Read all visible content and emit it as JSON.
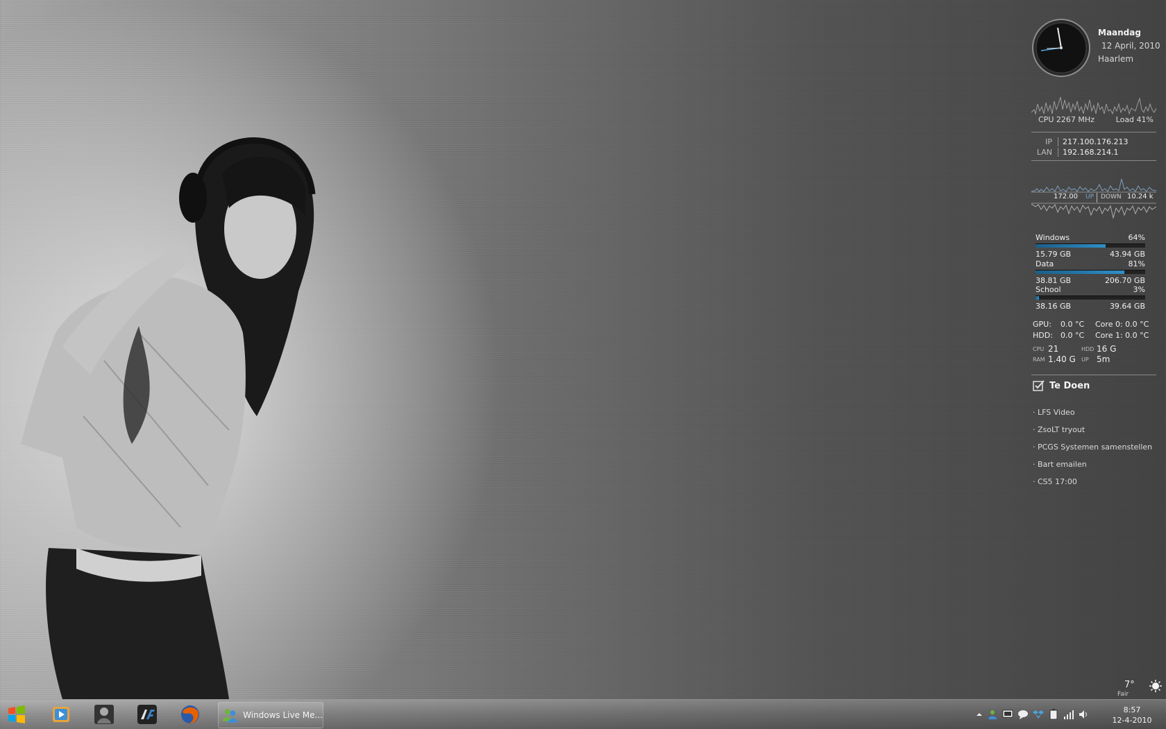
{
  "clock": {
    "day": "Maandag",
    "date": "12 April, 2010",
    "city": "Haarlem"
  },
  "cpu": {
    "mhz": "CPU 2267 MHz",
    "load": "Load 41%"
  },
  "network": {
    "ip_label": "IP",
    "ip": "217.100.176.213",
    "lan_label": "LAN",
    "lan": "192.168.214.1",
    "up_value": "172.00",
    "up_label": "UP",
    "down_label": "DOWN",
    "down_value": "10.24 k"
  },
  "drives": [
    {
      "name": "Windows",
      "percent_label": "64%",
      "used": "15.79 GB",
      "total": "43.94 GB",
      "fill": 0.64
    },
    {
      "name": "Data",
      "percent_label": "81%",
      "used": "38.81 GB",
      "total": "206.70 GB",
      "fill": 0.81
    },
    {
      "name": "School",
      "percent_label": "3%",
      "used": "38.16 GB",
      "total": "39.64 GB",
      "fill": 0.03
    }
  ],
  "temps": {
    "gpu_label": "GPU:",
    "gpu": "0.0 °C",
    "core0": "Core 0: 0.0 °C",
    "hdd_label": "HDD:",
    "hdd": "0.0 °C",
    "core1": "Core 1: 0.0 °C"
  },
  "mini": {
    "cpu_label": "CPU",
    "cpu": "21",
    "hdd_label": "HDD",
    "hdd": "16 G",
    "ram_label": "RAM",
    "ram": "1.40 G",
    "up_label": "UP",
    "up": "5m"
  },
  "todo": {
    "title": "Te Doen",
    "items": [
      "· LFS Video",
      "· ZsoLT tryout",
      "· PCGS Systemen samenstellen",
      "· Bart emailen",
      "· CS5 17:00"
    ]
  },
  "weather": {
    "temp": "7°",
    "condition": "Fair"
  },
  "taskbar": {
    "wlm_label": "Windows Live Me...",
    "time": "8:57",
    "date": "12-4-2010"
  },
  "colors": {
    "accent": "#2f8fc7",
    "graph": "#9aa9b5"
  }
}
